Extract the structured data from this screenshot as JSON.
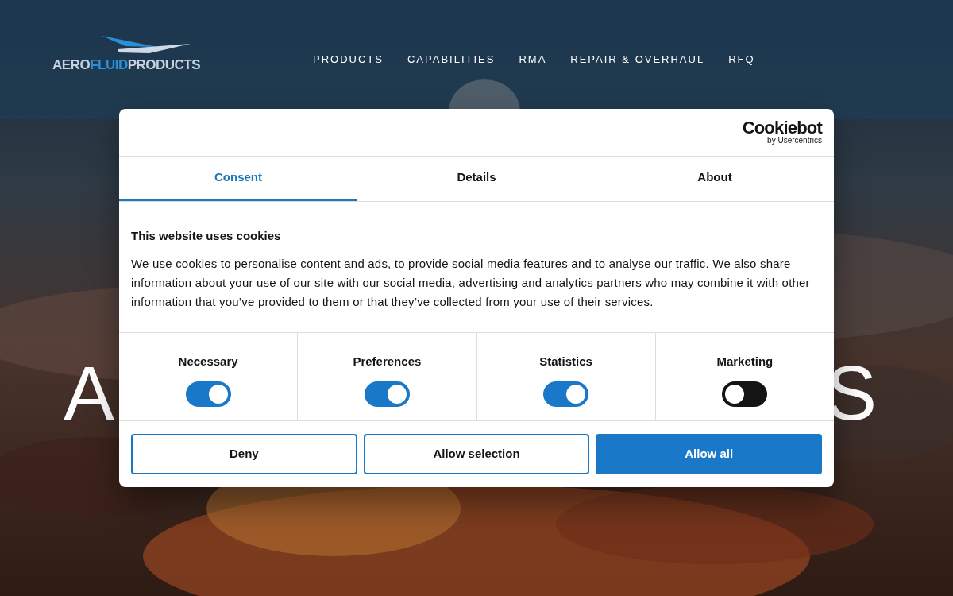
{
  "header": {
    "logo": {
      "parts": [
        "AERO",
        "FLUID",
        "PRODUCTS"
      ]
    },
    "nav": [
      "PRODUCTS",
      "CAPABILITIES",
      "RMA",
      "REPAIR & OVERHAUL",
      "RFQ"
    ]
  },
  "hero": {
    "kind": "picture",
    "fragments": [
      "A",
      "S"
    ]
  },
  "cookie_dialog": {
    "brand": {
      "name": "Cookiebot",
      "byline": "by Usercentrics"
    },
    "tabs": [
      {
        "label": "Consent",
        "selected": true
      },
      {
        "label": "Details",
        "selected": false
      },
      {
        "label": "About",
        "selected": false
      }
    ],
    "title": "This website uses cookies",
    "text": "We use cookies to personalise content and ads, to provide social media features and to analyse our traffic. We also share information about your use of our site with our social media, advertising and analytics partners who may combine it with other information that you’ve provided to them or that they’ve collected from your use of their services.",
    "toggles": [
      {
        "label": "Necessary",
        "on": true
      },
      {
        "label": "Preferences",
        "on": true
      },
      {
        "label": "Statistics",
        "on": true
      },
      {
        "label": "Marketing",
        "on": false
      }
    ],
    "buttons": [
      {
        "label": "Deny",
        "kind": "outline"
      },
      {
        "label": "Allow selection",
        "kind": "outline"
      },
      {
        "label": "Allow all",
        "kind": "primary"
      }
    ]
  }
}
